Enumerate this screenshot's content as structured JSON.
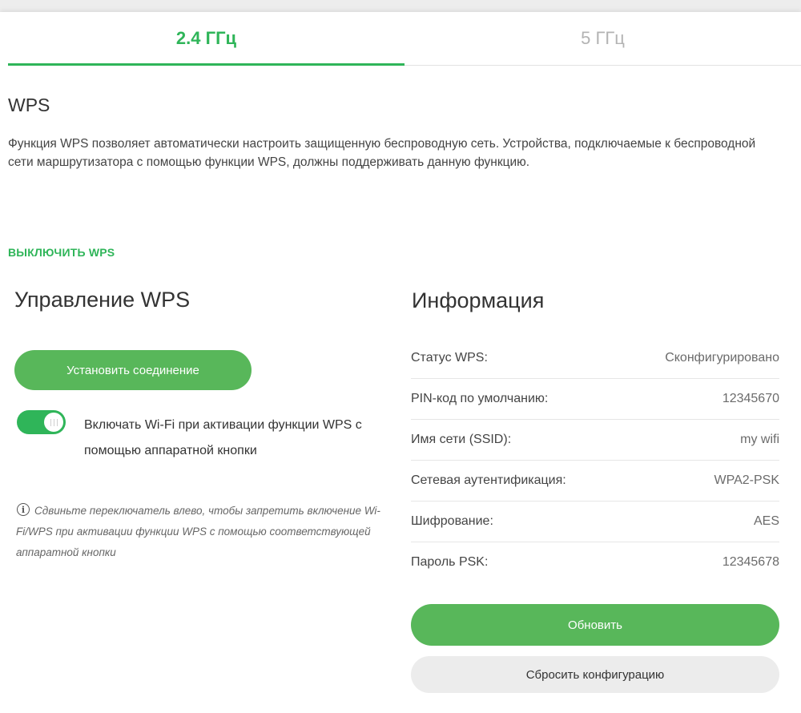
{
  "tabs": [
    {
      "label": "2.4 ГГц",
      "active": true
    },
    {
      "label": "5 ГГц",
      "active": false
    }
  ],
  "wps": {
    "title": "WPS",
    "description": "Функция WPS позволяет автоматически настроить защищенную беспроводную сеть. Устройства, подключаемые к беспроводной сети маршрутизатора с помощью функции WPS, должны поддерживать данную функцию.",
    "disable_link": "ВЫКЛЮЧИТЬ WPS"
  },
  "management": {
    "title": "Управление WPS",
    "connect_button": "Установить соединение",
    "toggle_on": true,
    "toggle_label": "Включать Wi-Fi при активации функции WPS с помощью аппаратной кнопки",
    "hint_icon": "info-icon",
    "hint": "Сдвиньте переключатель влево, чтобы запретить включение Wi-Fi/WPS при активации функции WPS с помощью соответствующей аппаратной кнопки"
  },
  "info": {
    "title": "Информация",
    "rows": [
      {
        "label": "Статус WPS:",
        "value": "Сконфигурировано"
      },
      {
        "label": "PIN-код по умолчанию:",
        "value": "12345670"
      },
      {
        "label": "Имя сети (SSID):",
        "value": "my wifi"
      },
      {
        "label": "Сетевая аутентификация:",
        "value": "WPA2-PSK"
      },
      {
        "label": "Шифрование:",
        "value": "AES"
      },
      {
        "label": "Пароль PSK:",
        "value": "12345678"
      }
    ],
    "refresh_button": "Обновить",
    "reset_button": "Сбросить конфигурацию"
  },
  "colors": {
    "accent": "#2fb559",
    "button_green": "#58b75a",
    "button_gray": "#ececec"
  }
}
